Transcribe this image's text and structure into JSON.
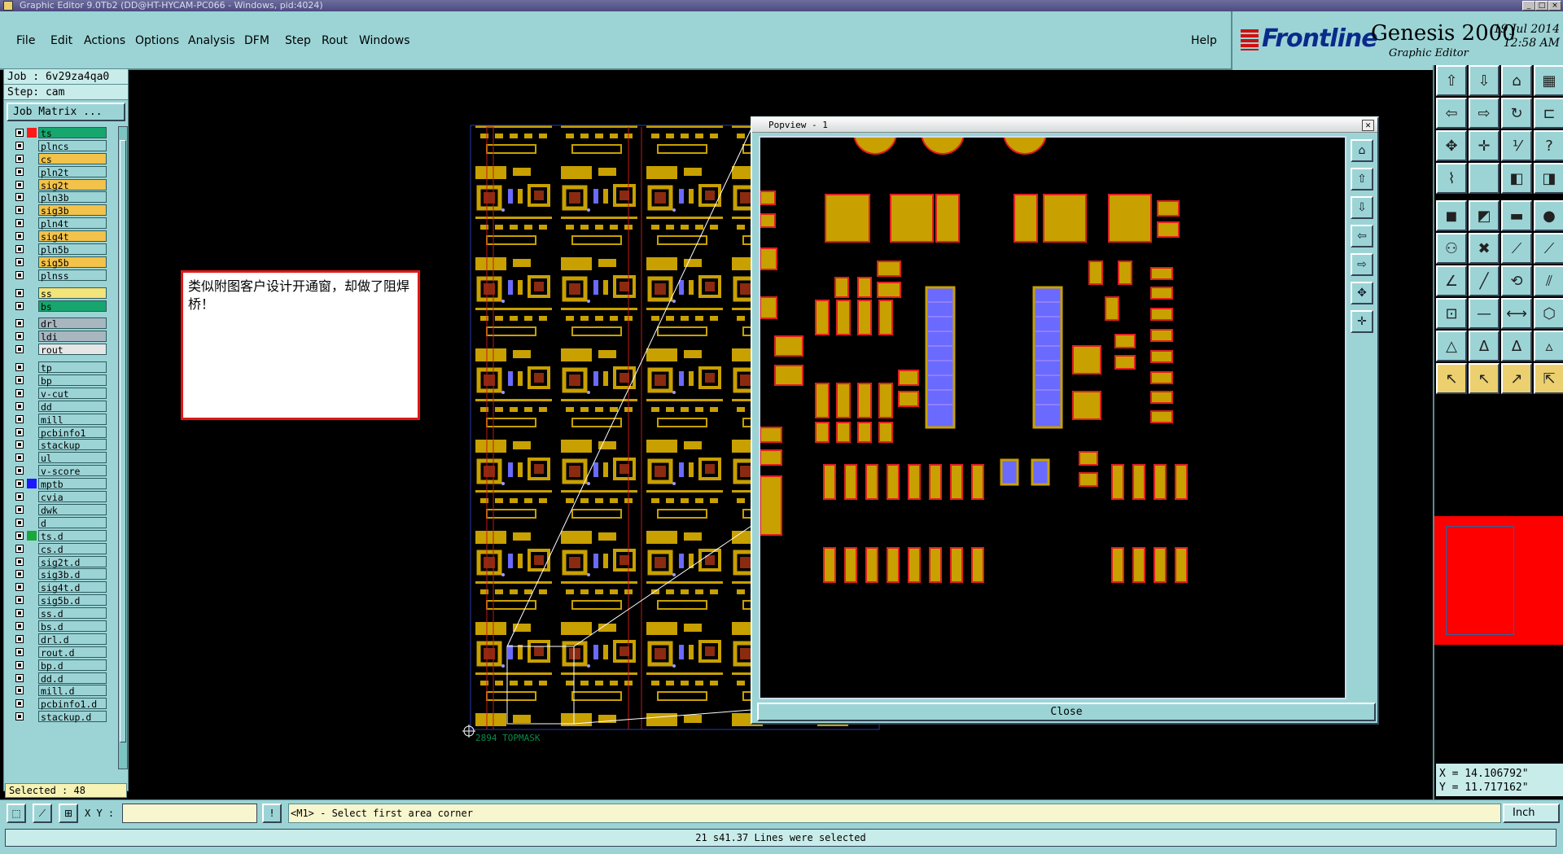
{
  "window": {
    "title": "Graphic Editor 9.0Tb2 (DD@HT-HYCAM-PC066 - Windows, pid:4024)"
  },
  "menu": {
    "file": "File",
    "edit": "Edit",
    "actions": "Actions",
    "options": "Options",
    "analysis": "Analysis",
    "dfm": "DFM",
    "step": "Step",
    "rout": "Rout",
    "windows": "Windows",
    "help": "Help"
  },
  "brand": {
    "logo": "Frontline",
    "product": "Genesis 2000",
    "subtitle": "Graphic Editor",
    "date": "19 Jul 2014",
    "time": "12:58 AM"
  },
  "job": {
    "job": "Job : 6v29za4qa0",
    "step": "Step: cam",
    "matrix_button": "Job Matrix ..."
  },
  "layers": [
    {
      "name": "ts",
      "color": "#16a66e",
      "swatch": "#ff1a1a"
    },
    {
      "name": "plncs",
      "color": "#9cd4d6"
    },
    {
      "name": "cs",
      "color": "#f2c24a"
    },
    {
      "name": "pln2t",
      "color": "#9cd4d6"
    },
    {
      "name": "sig2t",
      "color": "#f2c24a"
    },
    {
      "name": "pln3b",
      "color": "#9cd4d6"
    },
    {
      "name": "sig3b",
      "color": "#f2c24a"
    },
    {
      "name": "pln4t",
      "color": "#9cd4d6"
    },
    {
      "name": "sig4t",
      "color": "#f2c24a"
    },
    {
      "name": "pln5b",
      "color": "#9cd4d6"
    },
    {
      "name": "sig5b",
      "color": "#f2c24a"
    },
    {
      "name": "plnss",
      "color": "#9cd4d6"
    },
    {
      "name": "ss",
      "color": "#f2e47a",
      "gap": true
    },
    {
      "name": "bs",
      "color": "#16a66e"
    },
    {
      "name": "drl",
      "color": "#a8b6c0",
      "gap": true
    },
    {
      "name": "ldi",
      "color": "#a8b6c0"
    },
    {
      "name": "rout",
      "color": "#e6e6e6"
    },
    {
      "name": "tp",
      "color": "#9cd4d6",
      "gap": true
    },
    {
      "name": "bp",
      "color": "#9cd4d6"
    },
    {
      "name": "v-cut",
      "color": "#9cd4d6"
    },
    {
      "name": "dd",
      "color": "#9cd4d6"
    },
    {
      "name": "mill",
      "color": "#9cd4d6"
    },
    {
      "name": "pcbinfo1",
      "color": "#9cd4d6"
    },
    {
      "name": "stackup",
      "color": "#9cd4d6"
    },
    {
      "name": "ul",
      "color": "#9cd4d6"
    },
    {
      "name": "v-score",
      "color": "#9cd4d6"
    },
    {
      "name": "mptb",
      "color": "#9cd4d6",
      "swatch": "#1a1aff"
    },
    {
      "name": "cvia",
      "color": "#9cd4d6"
    },
    {
      "name": "dwk",
      "color": "#9cd4d6"
    },
    {
      "name": "d",
      "color": "#9cd4d6"
    },
    {
      "name": "ts.d",
      "color": "#9cd4d6",
      "swatch": "#1aa83a"
    },
    {
      "name": "cs.d",
      "color": "#9cd4d6"
    },
    {
      "name": "sig2t.d",
      "color": "#9cd4d6"
    },
    {
      "name": "sig3b.d",
      "color": "#9cd4d6"
    },
    {
      "name": "sig4t.d",
      "color": "#9cd4d6"
    },
    {
      "name": "sig5b.d",
      "color": "#9cd4d6"
    },
    {
      "name": "ss.d",
      "color": "#9cd4d6"
    },
    {
      "name": "bs.d",
      "color": "#9cd4d6"
    },
    {
      "name": "drl.d",
      "color": "#9cd4d6"
    },
    {
      "name": "rout.d",
      "color": "#9cd4d6"
    },
    {
      "name": "bp.d",
      "color": "#9cd4d6"
    },
    {
      "name": "dd.d",
      "color": "#9cd4d6"
    },
    {
      "name": "mill.d",
      "color": "#9cd4d6"
    },
    {
      "name": "pcbinfo1.d",
      "color": "#9cd4d6"
    },
    {
      "name": "stackup.d",
      "color": "#9cd4d6"
    }
  ],
  "selected": "Selected : 48",
  "annotation": "类似附图客户设计开通窗，却做了阻焊桥！",
  "pcb_caption": "2894  TOPMASK",
  "popview": {
    "title": "Popview - 1",
    "close_label": "Close",
    "close_x": "✕"
  },
  "coords": {
    "x": "X = 14.106792\"",
    "y": "Y = 11.717162\""
  },
  "command": {
    "xy_label": "X Y :",
    "xy_value": "",
    "prompt": "<M1> - Select first area corner",
    "units": "Inch",
    "info": "!"
  },
  "status": "21 s41.37 Lines were selected",
  "colors": {
    "panel": "#9cd4d6",
    "copper": "#c8a000",
    "soldermask": "#6a6aff",
    "highlight": "#ff0000"
  }
}
